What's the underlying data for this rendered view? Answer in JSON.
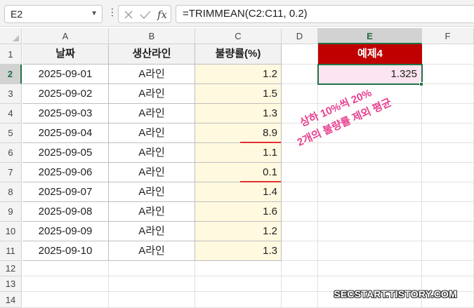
{
  "name_box": "E2",
  "formula_bar": {
    "fx_label": "fx",
    "formula": "=TRIMMEAN(C2:C11, 0.2)"
  },
  "column_headers": [
    "A",
    "B",
    "C",
    "D",
    "E",
    "F"
  ],
  "row_headers": [
    "1",
    "2",
    "3",
    "4",
    "5",
    "6",
    "7",
    "8",
    "9",
    "10",
    "11",
    "12",
    "13",
    "14"
  ],
  "table": {
    "headers": [
      "날짜",
      "생산라인",
      "불량률(%)"
    ],
    "rows": [
      [
        "2025-09-01",
        "A라인",
        "1.2"
      ],
      [
        "2025-09-02",
        "A라인",
        "1.5"
      ],
      [
        "2025-09-03",
        "A라인",
        "1.3"
      ],
      [
        "2025-09-04",
        "A라인",
        "8.9"
      ],
      [
        "2025-09-05",
        "A라인",
        "1.1"
      ],
      [
        "2025-09-06",
        "A라인",
        "0.1"
      ],
      [
        "2025-09-07",
        "A라인",
        "1.4"
      ],
      [
        "2025-09-08",
        "A라인",
        "1.6"
      ],
      [
        "2025-09-09",
        "A라인",
        "1.2"
      ],
      [
        "2025-09-10",
        "A라인",
        "1.3"
      ]
    ]
  },
  "example": {
    "title": "예제4",
    "result": "1.325"
  },
  "annotation": {
    "line1": "상하 10%씩 20%",
    "line2": "2개의 불량률 제외 평균"
  },
  "watermark": "SECSTART.TISTORY.COM",
  "colors": {
    "accent_green": "#217346",
    "example_header_red": "#c00000",
    "result_fill": "#fce4f0",
    "annotation_pink": "#e84090",
    "underline_red": "#e03030",
    "value_column_fill": "#fff9e0"
  }
}
